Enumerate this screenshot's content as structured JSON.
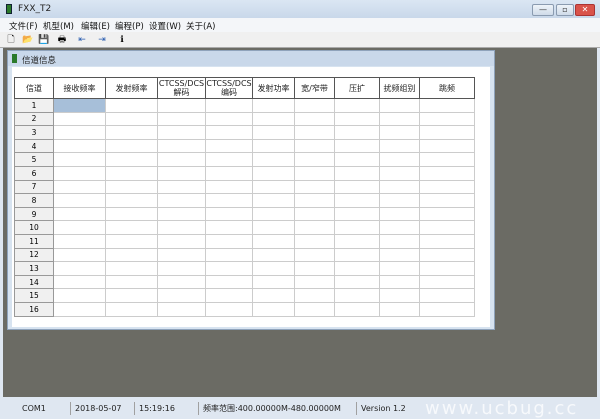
{
  "window": {
    "title": "FXX_T2",
    "minimize": "—",
    "maximize": "▫",
    "close": "✕"
  },
  "menu": [
    "文件(F)",
    "机型(M)",
    "编辑(E)",
    "编程(P)",
    "设置(W)",
    "关于(A)"
  ],
  "toolbar": [
    {
      "icon": "new-icon",
      "glyph": "🗋"
    },
    {
      "icon": "open-icon",
      "glyph": "📂"
    },
    {
      "icon": "save-icon",
      "glyph": "💾"
    },
    {
      "icon": "print-icon",
      "glyph": "🖶"
    },
    {
      "icon": "read-icon",
      "glyph": "⇤"
    },
    {
      "icon": "write-icon",
      "glyph": "⇥"
    },
    {
      "icon": "info-icon",
      "glyph": "ℹ"
    }
  ],
  "child": {
    "title": "信道信息"
  },
  "table": {
    "headers": [
      "信道",
      "接收频率",
      "发射频率",
      "CTCSS/DCS\n解码",
      "CTCSS/DCS\n编码",
      "发射功率",
      "宽/窄带",
      "压扩",
      "扰频组别",
      "跳频"
    ],
    "rows": [
      "1",
      "2",
      "3",
      "4",
      "5",
      "6",
      "7",
      "8",
      "9",
      "10",
      "11",
      "12",
      "13",
      "14",
      "15",
      "16"
    ],
    "selected": {
      "row": 1,
      "column": "接收频率"
    }
  },
  "status": {
    "port": "COM1",
    "date": "2018-05-07",
    "time": "15:19:16",
    "range": "频率范围:400.00000M-480.00000M",
    "version": "Version 1.2"
  },
  "watermark": "www.ucbug.cc"
}
